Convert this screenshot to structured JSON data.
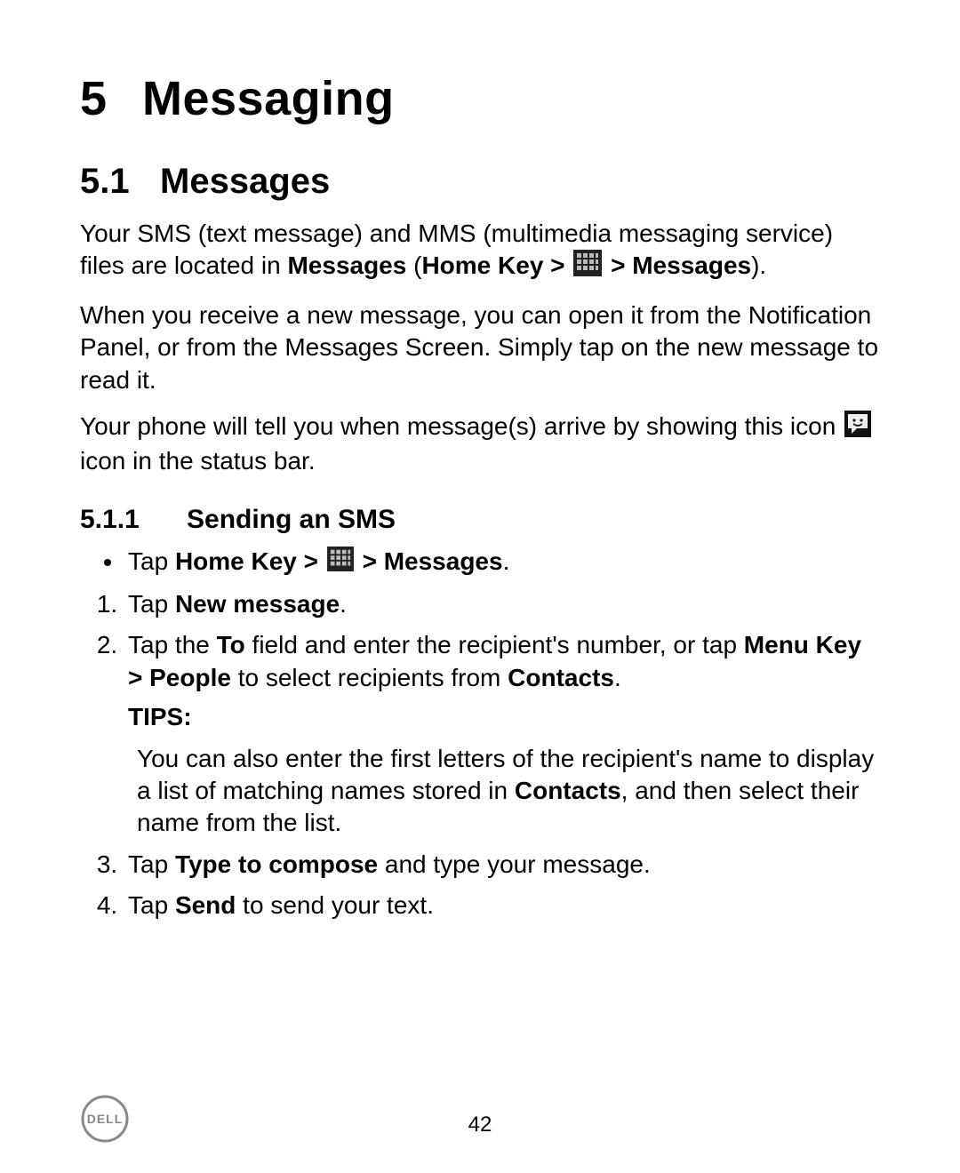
{
  "chapter": {
    "number": "5",
    "title": "Messaging"
  },
  "section": {
    "number": "5.1",
    "title": "Messages"
  },
  "para1": {
    "a": "Your SMS (text message) and MMS (multimedia messaging service) files are located in ",
    "b": "Messages",
    "c": " (",
    "d": "Home Key > ",
    "e": " > Messages",
    "f": ")."
  },
  "para2": "When you receive a new message, you can open it from the Notification Panel, or from the Messages Screen. Simply tap on the new message to read it.",
  "para3": {
    "a": "Your phone will tell you when message(s) arrive by showing this icon ",
    "b": " icon in the status bar."
  },
  "subsection": {
    "number": "5.1.1",
    "title": "Sending an SMS"
  },
  "bullet1": {
    "a": "Tap ",
    "b": "Home Key > ",
    "c": " > Messages",
    "d": "."
  },
  "step1": {
    "a": "Tap ",
    "b": "New message",
    "c": "."
  },
  "step2": {
    "a": "Tap the ",
    "b": "To",
    "c": " field and enter the recipient's number, or tap ",
    "d": "Menu Key > People",
    "e": " to select recipients from ",
    "f": "Contacts",
    "g": "."
  },
  "tips_label": "TIPS:",
  "tips_body": {
    "a": "You can also enter the first letters of the recipient's name to display a list of matching names stored in ",
    "b": "Contacts",
    "c": ", and then select their name from the list."
  },
  "step3": {
    "a": "Tap ",
    "b": "Type to compose",
    "c": " and type your message."
  },
  "step4": {
    "a": "Tap ",
    "b": "Send",
    "c": " to send your text."
  },
  "page_number": "42",
  "icons": {
    "apps_grid": "apps-grid-icon",
    "sms_notify": "sms-notification-icon",
    "dell": "dell-logo"
  }
}
